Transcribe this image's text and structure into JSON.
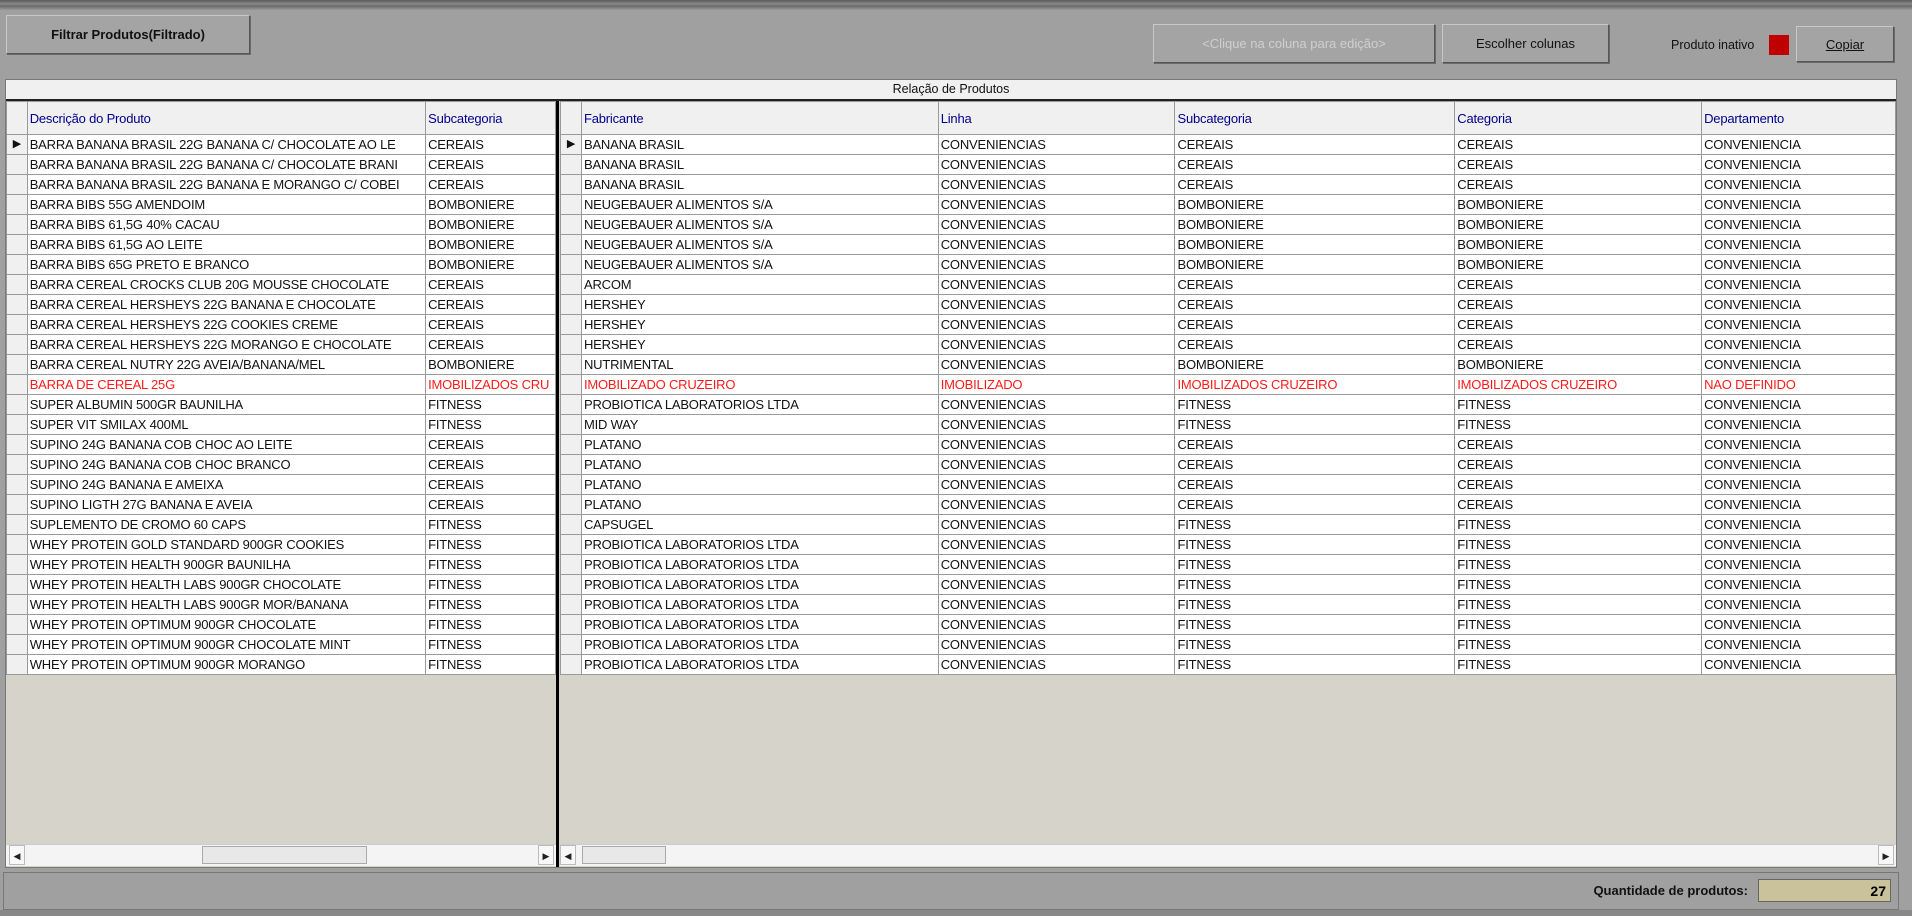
{
  "toolbar": {
    "filter_button": "Filtrar Produtos(Filtrado)",
    "edit_hint_button": "<Clique na coluna para edição>",
    "choose_columns_button": "Escolher colunas",
    "inactive_label": "Produto inativo",
    "inactive_color": "#c00000",
    "copy_button": "Copiar"
  },
  "grid": {
    "title": "Relação de Produtos",
    "left_headers": [
      "Descrição do Produto",
      "Subcategoria"
    ],
    "right_headers": [
      "Fabricante",
      "Linha",
      "Subcategoria",
      "Categoria",
      "Departamento"
    ],
    "rows": [
      {
        "left": [
          "BARRA BANANA BRASIL 22G BANANA C/ CHOCOLATE AO LE",
          "CEREAIS"
        ],
        "right": [
          "BANANA BRASIL",
          "CONVENIENCIAS",
          "CEREAIS",
          "CEREAIS",
          "CONVENIENCIA"
        ],
        "inactive": false,
        "current": true
      },
      {
        "left": [
          "BARRA BANANA BRASIL 22G BANANA C/ CHOCOLATE BRANI",
          "CEREAIS"
        ],
        "right": [
          "BANANA BRASIL",
          "CONVENIENCIAS",
          "CEREAIS",
          "CEREAIS",
          "CONVENIENCIA"
        ],
        "inactive": false
      },
      {
        "left": [
          "BARRA BANANA BRASIL 22G BANANA E MORANGO C/ COBEI",
          "CEREAIS"
        ],
        "right": [
          "BANANA BRASIL",
          "CONVENIENCIAS",
          "CEREAIS",
          "CEREAIS",
          "CONVENIENCIA"
        ],
        "inactive": false
      },
      {
        "left": [
          "BARRA BIBS 55G AMENDOIM",
          "BOMBONIERE"
        ],
        "right": [
          "NEUGEBAUER ALIMENTOS S/A",
          "CONVENIENCIAS",
          "BOMBONIERE",
          "BOMBONIERE",
          "CONVENIENCIA"
        ],
        "inactive": false
      },
      {
        "left": [
          "BARRA BIBS 61,5G 40% CACAU",
          "BOMBONIERE"
        ],
        "right": [
          "NEUGEBAUER ALIMENTOS S/A",
          "CONVENIENCIAS",
          "BOMBONIERE",
          "BOMBONIERE",
          "CONVENIENCIA"
        ],
        "inactive": false
      },
      {
        "left": [
          "BARRA BIBS 61,5G AO LEITE",
          "BOMBONIERE"
        ],
        "right": [
          "NEUGEBAUER ALIMENTOS S/A",
          "CONVENIENCIAS",
          "BOMBONIERE",
          "BOMBONIERE",
          "CONVENIENCIA"
        ],
        "inactive": false
      },
      {
        "left": [
          "BARRA BIBS 65G PRETO E BRANCO",
          "BOMBONIERE"
        ],
        "right": [
          "NEUGEBAUER ALIMENTOS S/A",
          "CONVENIENCIAS",
          "BOMBONIERE",
          "BOMBONIERE",
          "CONVENIENCIA"
        ],
        "inactive": false
      },
      {
        "left": [
          "BARRA CEREAL CROCKS CLUB 20G MOUSSE CHOCOLATE",
          "CEREAIS"
        ],
        "right": [
          "ARCOM",
          "CONVENIENCIAS",
          "CEREAIS",
          "CEREAIS",
          "CONVENIENCIA"
        ],
        "inactive": false
      },
      {
        "left": [
          "BARRA CEREAL HERSHEYS 22G BANANA E CHOCOLATE",
          "CEREAIS"
        ],
        "right": [
          "HERSHEY",
          "CONVENIENCIAS",
          "CEREAIS",
          "CEREAIS",
          "CONVENIENCIA"
        ],
        "inactive": false
      },
      {
        "left": [
          "BARRA CEREAL HERSHEYS 22G COOKIES CREME",
          "CEREAIS"
        ],
        "right": [
          "HERSHEY",
          "CONVENIENCIAS",
          "CEREAIS",
          "CEREAIS",
          "CONVENIENCIA"
        ],
        "inactive": false
      },
      {
        "left": [
          "BARRA CEREAL HERSHEYS 22G MORANGO E CHOCOLATE",
          "CEREAIS"
        ],
        "right": [
          "HERSHEY",
          "CONVENIENCIAS",
          "CEREAIS",
          "CEREAIS",
          "CONVENIENCIA"
        ],
        "inactive": false
      },
      {
        "left": [
          "BARRA CEREAL NUTRY 22G AVEIA/BANANA/MEL",
          "BOMBONIERE"
        ],
        "right": [
          "NUTRIMENTAL",
          "CONVENIENCIAS",
          "BOMBONIERE",
          "BOMBONIERE",
          "CONVENIENCIA"
        ],
        "inactive": false
      },
      {
        "left": [
          "BARRA DE CEREAL 25G",
          "IMOBILIZADOS CRU"
        ],
        "right": [
          "IMOBILIZADO CRUZEIRO",
          "IMOBILIZADO",
          "IMOBILIZADOS CRUZEIRO",
          "IMOBILIZADOS CRUZEIRO",
          "NAO DEFINIDO"
        ],
        "inactive": true
      },
      {
        "left": [
          "SUPER ALBUMIN  500GR BAUNILHA",
          "FITNESS"
        ],
        "right": [
          "PROBIOTICA LABORATORIOS LTDA",
          "CONVENIENCIAS",
          "FITNESS",
          "FITNESS",
          "CONVENIENCIA"
        ],
        "inactive": false
      },
      {
        "left": [
          "SUPER VIT SMILAX 400ML",
          "FITNESS"
        ],
        "right": [
          "MID WAY",
          "CONVENIENCIAS",
          "FITNESS",
          "FITNESS",
          "CONVENIENCIA"
        ],
        "inactive": false
      },
      {
        "left": [
          "SUPINO 24G BANANA COB CHOC AO LEITE",
          "CEREAIS"
        ],
        "right": [
          "PLATANO",
          "CONVENIENCIAS",
          "CEREAIS",
          "CEREAIS",
          "CONVENIENCIA"
        ],
        "inactive": false
      },
      {
        "left": [
          "SUPINO 24G BANANA COB CHOC BRANCO",
          "CEREAIS"
        ],
        "right": [
          "PLATANO",
          "CONVENIENCIAS",
          "CEREAIS",
          "CEREAIS",
          "CONVENIENCIA"
        ],
        "inactive": false
      },
      {
        "left": [
          "SUPINO 24G BANANA E AMEIXA",
          "CEREAIS"
        ],
        "right": [
          "PLATANO",
          "CONVENIENCIAS",
          "CEREAIS",
          "CEREAIS",
          "CONVENIENCIA"
        ],
        "inactive": false
      },
      {
        "left": [
          "SUPINO LIGTH 27G BANANA E AVEIA",
          "CEREAIS"
        ],
        "right": [
          "PLATANO",
          "CONVENIENCIAS",
          "CEREAIS",
          "CEREAIS",
          "CONVENIENCIA"
        ],
        "inactive": false
      },
      {
        "left": [
          "SUPLEMENTO DE CROMO 60 CAPS",
          "FITNESS"
        ],
        "right": [
          "CAPSUGEL",
          "CONVENIENCIAS",
          "FITNESS",
          "FITNESS",
          "CONVENIENCIA"
        ],
        "inactive": false
      },
      {
        "left": [
          "WHEY PROTEIN GOLD STANDARD 900GR COOKIES",
          "FITNESS"
        ],
        "right": [
          "PROBIOTICA LABORATORIOS LTDA",
          "CONVENIENCIAS",
          "FITNESS",
          "FITNESS",
          "CONVENIENCIA"
        ],
        "inactive": false
      },
      {
        "left": [
          "WHEY PROTEIN HEALTH 900GR BAUNILHA",
          "FITNESS"
        ],
        "right": [
          "PROBIOTICA LABORATORIOS LTDA",
          "CONVENIENCIAS",
          "FITNESS",
          "FITNESS",
          "CONVENIENCIA"
        ],
        "inactive": false
      },
      {
        "left": [
          "WHEY PROTEIN HEALTH LABS  900GR CHOCOLATE",
          "FITNESS"
        ],
        "right": [
          "PROBIOTICA LABORATORIOS LTDA",
          "CONVENIENCIAS",
          "FITNESS",
          "FITNESS",
          "CONVENIENCIA"
        ],
        "inactive": false
      },
      {
        "left": [
          "WHEY PROTEIN HEALTH LABS  900GR MOR/BANANA",
          "FITNESS"
        ],
        "right": [
          "PROBIOTICA LABORATORIOS LTDA",
          "CONVENIENCIAS",
          "FITNESS",
          "FITNESS",
          "CONVENIENCIA"
        ],
        "inactive": false
      },
      {
        "left": [
          "WHEY PROTEIN OPTIMUM 900GR CHOCOLATE",
          "FITNESS"
        ],
        "right": [
          "PROBIOTICA LABORATORIOS LTDA",
          "CONVENIENCIAS",
          "FITNESS",
          "FITNESS",
          "CONVENIENCIA"
        ],
        "inactive": false
      },
      {
        "left": [
          "WHEY PROTEIN OPTIMUM 900GR CHOCOLATE MINT",
          "FITNESS"
        ],
        "right": [
          "PROBIOTICA LABORATORIOS LTDA",
          "CONVENIENCIAS",
          "FITNESS",
          "FITNESS",
          "CONVENIENCIA"
        ],
        "inactive": false
      },
      {
        "left": [
          "WHEY PROTEIN OPTIMUM 900GR MORANGO",
          "FITNESS"
        ],
        "right": [
          "PROBIOTICA LABORATORIOS LTDA",
          "CONVENIENCIAS",
          "FITNESS",
          "FITNESS",
          "CONVENIENCIA"
        ],
        "inactive": false
      }
    ]
  },
  "status": {
    "quantity_label": "Quantidade de produtos:",
    "quantity_value": "27"
  }
}
